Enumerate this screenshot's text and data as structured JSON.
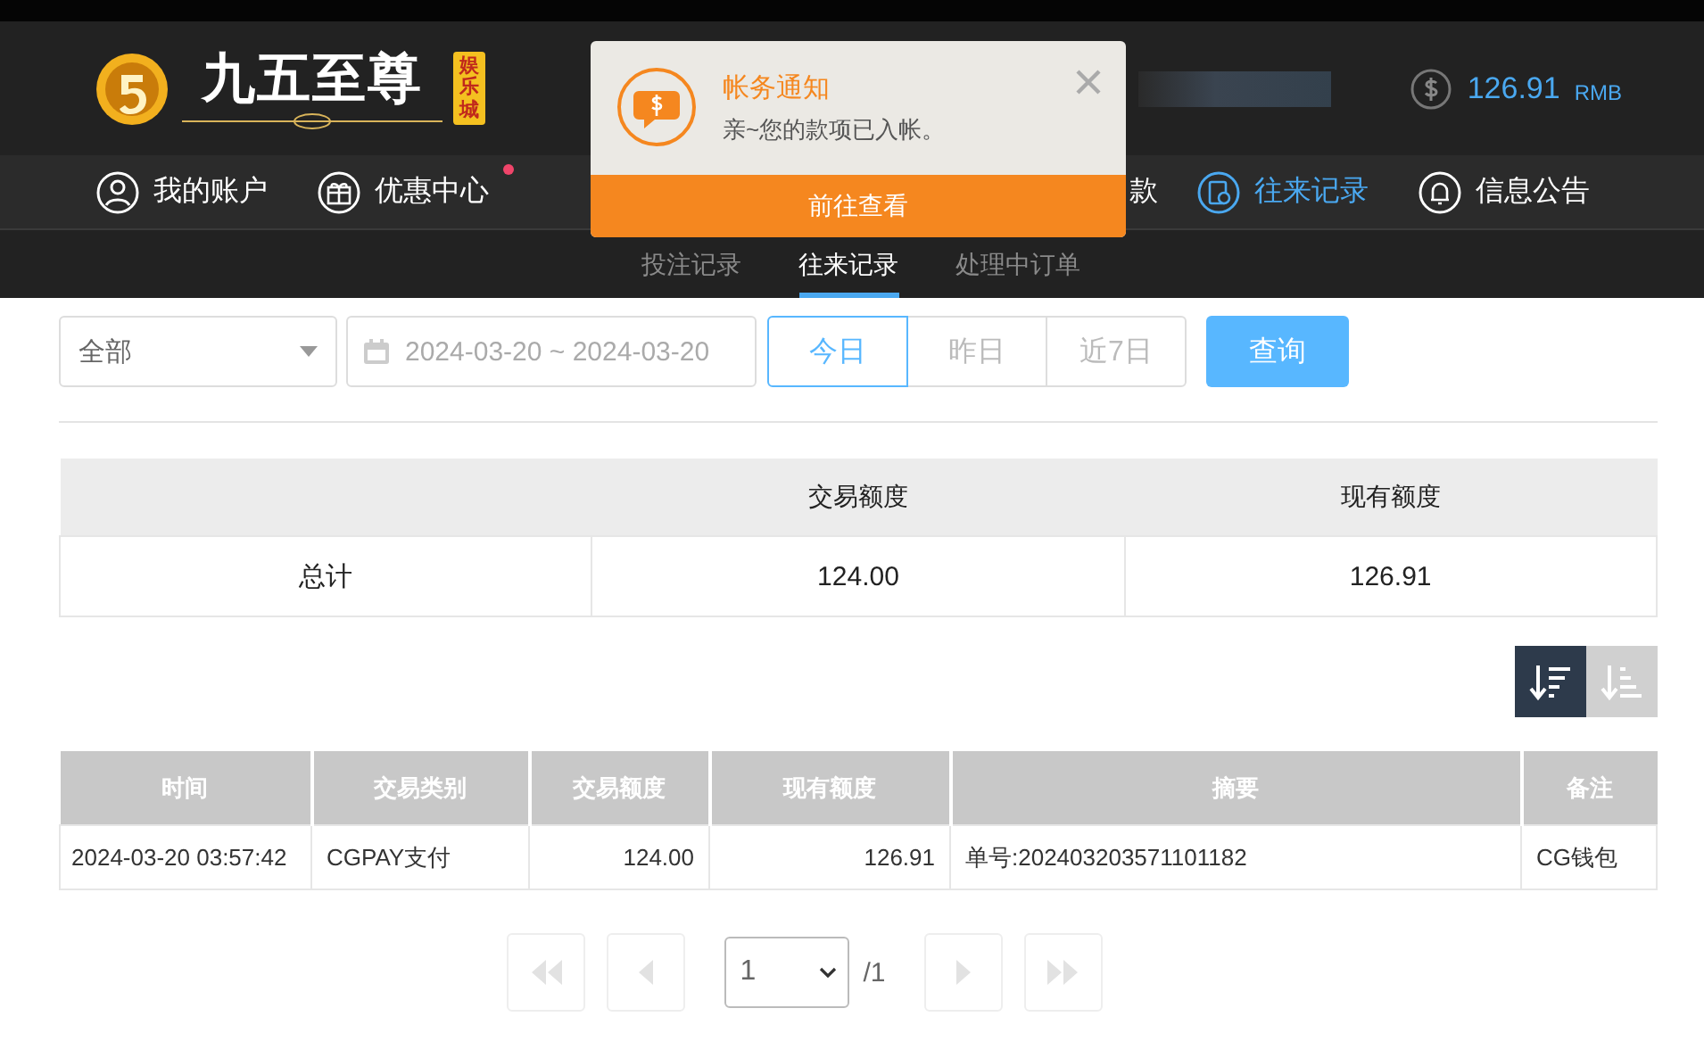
{
  "header": {
    "logo_text": "九五至尊",
    "logo_badge": "娱乐城",
    "balance": "126.91",
    "currency": "RMB"
  },
  "nav": [
    {
      "kind": "item",
      "label": "我的账户",
      "selected": false,
      "dot": false
    },
    {
      "kind": "item",
      "label": "优惠中心",
      "selected": false,
      "dot": true
    },
    {
      "kind": "covered"
    },
    {
      "kind": "item",
      "label": "款",
      "selected": false,
      "dot": false
    },
    {
      "kind": "item",
      "label": "往来记录",
      "selected": true,
      "dot": false
    },
    {
      "kind": "item",
      "label": "信息公告",
      "selected": false,
      "dot": false
    }
  ],
  "subnav": [
    {
      "label": "投注记录",
      "selected": false
    },
    {
      "label": "往来记录",
      "selected": true
    },
    {
      "label": "处理中订单",
      "selected": false
    }
  ],
  "notification": {
    "title": "帐务通知",
    "message": "亲~您的款项已入帐。",
    "button": "前往查看"
  },
  "filter": {
    "type_select": "全部",
    "date_range": "2024-03-20 ~ 2024-03-20",
    "ranges": [
      {
        "label": "今日",
        "selected": true
      },
      {
        "label": "昨日",
        "selected": false
      },
      {
        "label": "近7日",
        "selected": false
      }
    ],
    "query_button": "查询"
  },
  "summary": {
    "columns": [
      "交易额度",
      "现有额度"
    ],
    "row": {
      "label": "总计",
      "values": [
        "124.00",
        "126.91"
      ]
    }
  },
  "sort": [
    {
      "selected": true
    },
    {
      "selected": false
    }
  ],
  "table": {
    "columns": [
      "时间",
      "交易类别",
      "交易额度",
      "现有额度",
      "摘要",
      "备注"
    ],
    "rows": [
      [
        "2024-03-20 03:57:42",
        "CGPAY支付",
        "124.00",
        "126.91",
        "单号:202403203571101182",
        "CG钱包"
      ]
    ]
  },
  "pagination": {
    "page": "1",
    "total": "/1"
  }
}
